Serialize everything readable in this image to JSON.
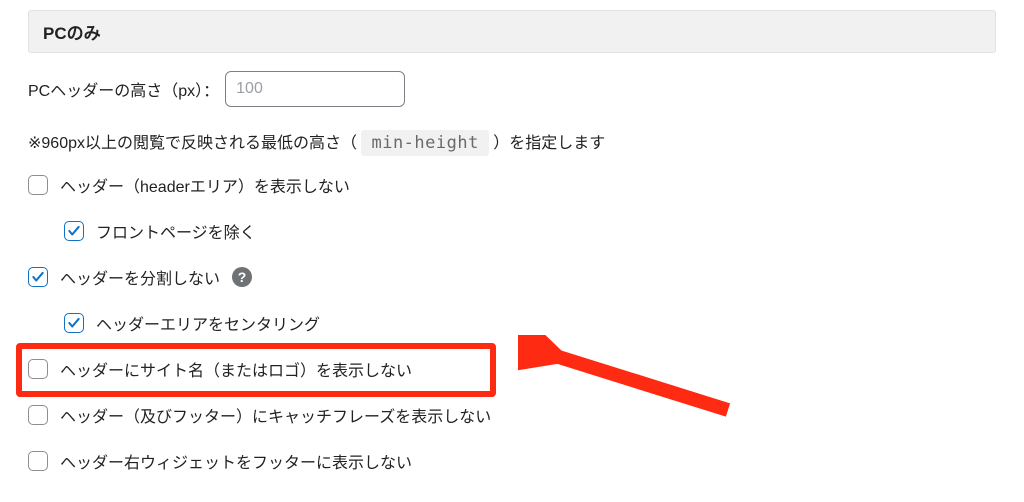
{
  "section": {
    "heading": "PCのみ"
  },
  "headerHeight": {
    "label": "PCヘッダーの高さ（px）：",
    "value": "",
    "placeholder": "100"
  },
  "helpText": {
    "prefix": "※960px以上の閲覧で反映される最低の高さ（",
    "code": "min-height",
    "suffix": "）を指定します"
  },
  "options": {
    "hideHeader": {
      "label": "ヘッダー（headerエリア）を表示しない",
      "checked": false
    },
    "excludeFront": {
      "label": "フロントページを除く",
      "checked": true
    },
    "noSplit": {
      "label": "ヘッダーを分割しない",
      "checked": true
    },
    "centerHeader": {
      "label": "ヘッダーエリアをセンタリング",
      "checked": true
    },
    "hideSiteName": {
      "label": "ヘッダーにサイト名（またはロゴ）を表示しない",
      "checked": false
    },
    "hideCatchphrase": {
      "label": "ヘッダー（及びフッター）にキャッチフレーズを表示しない",
      "checked": false
    },
    "rightWidgetFooter": {
      "label": "ヘッダー右ウィジェットをフッターに表示しない",
      "checked": false
    }
  },
  "tooltip": {
    "glyph": "?"
  },
  "colors": {
    "highlight": "#ff2a12",
    "check": "#1172c4"
  }
}
